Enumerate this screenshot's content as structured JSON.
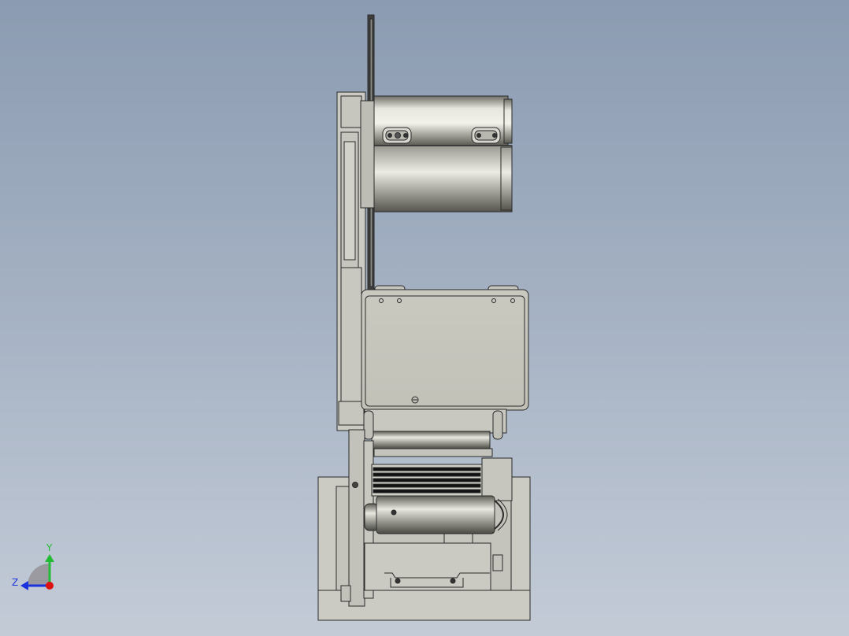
{
  "view": {
    "background_top": "#8b9bb1",
    "background_bottom": "#c3cbd7",
    "part_fill": "#cbcbc3",
    "part_stroke": "#2a2a2a"
  },
  "triad": {
    "y_label": "Y",
    "z_label": "Z",
    "y_color": "#22bb33",
    "z_color": "#1a33dd",
    "x_color": "#dd1111"
  }
}
